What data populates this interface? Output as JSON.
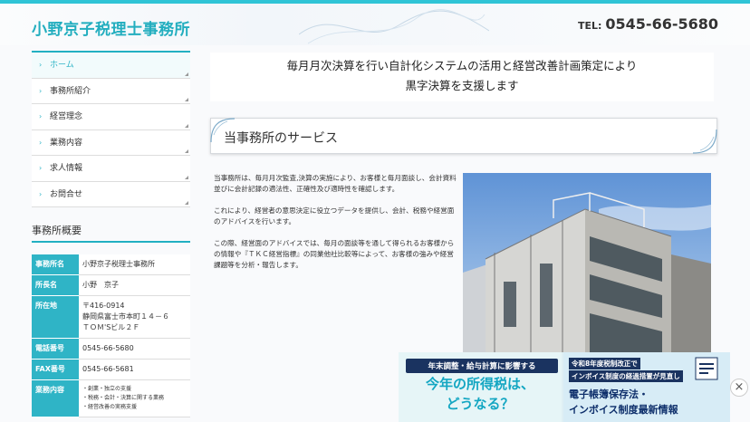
{
  "header": {
    "site_title": "小野京子税理士事務所",
    "tel_label": "TEL:",
    "tel_number": "0545-66-5680"
  },
  "menu": [
    {
      "label": "ホーム",
      "active": true
    },
    {
      "label": "事務所紹介"
    },
    {
      "label": "経営理念"
    },
    {
      "label": "業務内容"
    },
    {
      "label": "求人情報"
    },
    {
      "label": "お問合せ"
    }
  ],
  "overview": {
    "title": "事務所概要",
    "rows": [
      {
        "key": "事務所名",
        "value": "小野京子税理士事務所"
      },
      {
        "key": "所長名",
        "value": "小野　京子"
      },
      {
        "key": "所在地",
        "lines": [
          "〒416-0914",
          "静岡県富士市本町１４－６",
          "ＴＯＭ'Sビル２Ｆ"
        ]
      },
      {
        "key": "電話番号",
        "value": "0545-66-5680"
      },
      {
        "key": "FAX番号",
        "value": "0545-66-5681"
      },
      {
        "key": "業務内容",
        "lines": [
          "・創業・独立の支援",
          "・税務・会計・決算に関する業務",
          "・経営改善の実務支援"
        ]
      }
    ]
  },
  "headline": {
    "line1": "毎月月次決算を行い自計化システムの活用と経営改善計画策定により",
    "line2": "黒字決算を支援します"
  },
  "services": {
    "title": "当事務所のサービス",
    "paragraphs": [
      "当事務所は、毎月月次監査,決算の実施により、お客様と毎月面談し、会計資料並びに会計記録の適法性、正確性及び適時性を確認します。",
      "これにより、経営者の意思決定に役立つデータを提供し、会計、税務や経営面のアドバイスを行います。",
      "この際、経営面のアドバイスでは、毎月の面談等を通して得られるお客様からの情報や『ＴＫＣ経営指標』の同業他社比較等によって、お客様の強みや経営課題等を分析・報告します。"
    ]
  },
  "banner": {
    "left_top": "年末調整・給与計算に影響する",
    "left_line1": "今年の所得税は、",
    "left_line2": "どうなる？",
    "right_tag1": "令和8年度税制改正で",
    "right_tag2": "インボイス制度の経過措置が見直し",
    "right_line1": "電子帳簿保存法・",
    "right_line2": "インボイス制度最新情報",
    "close": "×"
  },
  "colors": {
    "accent": "#2fb4c6",
    "banner_navy": "#1a3360"
  }
}
